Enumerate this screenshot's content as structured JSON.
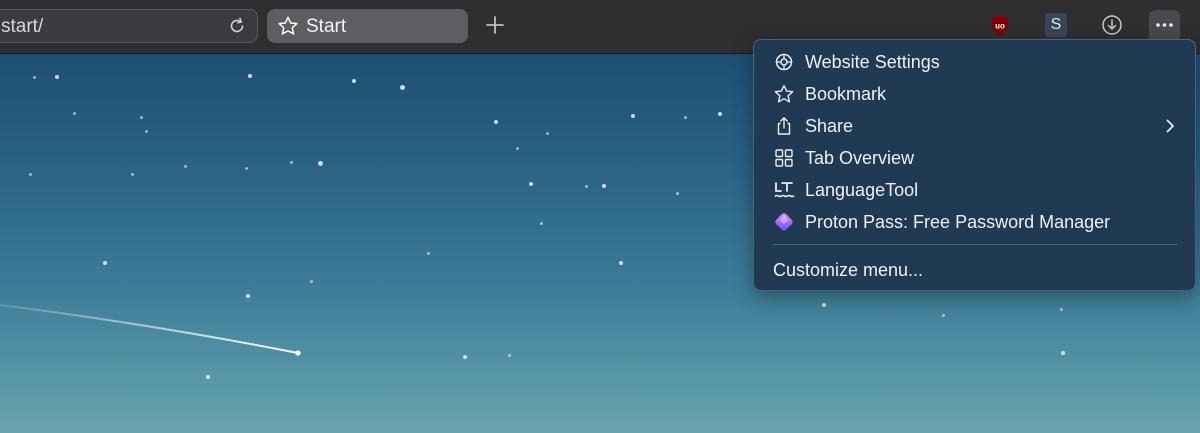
{
  "toolbar": {
    "url_text": "start/",
    "tab_title": "Start"
  },
  "extensions": {
    "s_label": "S"
  },
  "menu": {
    "items": [
      {
        "label": "Website Settings",
        "icon": "settings-gear-icon"
      },
      {
        "label": "Bookmark",
        "icon": "star-outline-icon"
      },
      {
        "label": "Share",
        "icon": "share-icon",
        "has_submenu": true
      },
      {
        "label": "Tab Overview",
        "icon": "grid-icon"
      },
      {
        "label": "LanguageTool",
        "icon": "languagetool-icon"
      },
      {
        "label": "Proton Pass: Free Password Manager",
        "icon": "proton-pass-icon"
      }
    ],
    "customize_label": "Customize menu..."
  },
  "colors": {
    "menu_bg": "#1f3a52",
    "toolbar_bg": "#2f2f32",
    "sky_top": "#1e4f73",
    "sky_bottom": "#6aa3ac"
  }
}
